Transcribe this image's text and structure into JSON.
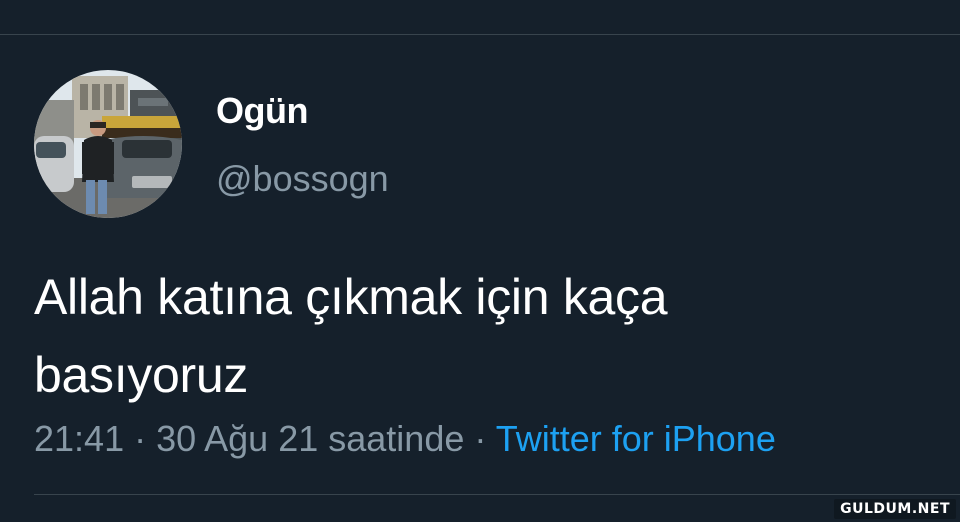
{
  "user": {
    "display_name": "Ogün",
    "handle": "@bossogn"
  },
  "tweet": {
    "text_line1": "Allah katına çıkmak için kaça",
    "text_line2": "basıyoruz",
    "time": "21:41",
    "separator1": " · ",
    "date": "30 Ağu 21 saatinde",
    "separator2": " · ",
    "source": "Twitter for iPhone"
  },
  "watermark": "GULDUM.NET",
  "colors": {
    "background": "#15202b",
    "primary_text": "#ffffff",
    "secondary_text": "#8899a6",
    "link": "#1da1f2",
    "divider": "#38444d"
  }
}
